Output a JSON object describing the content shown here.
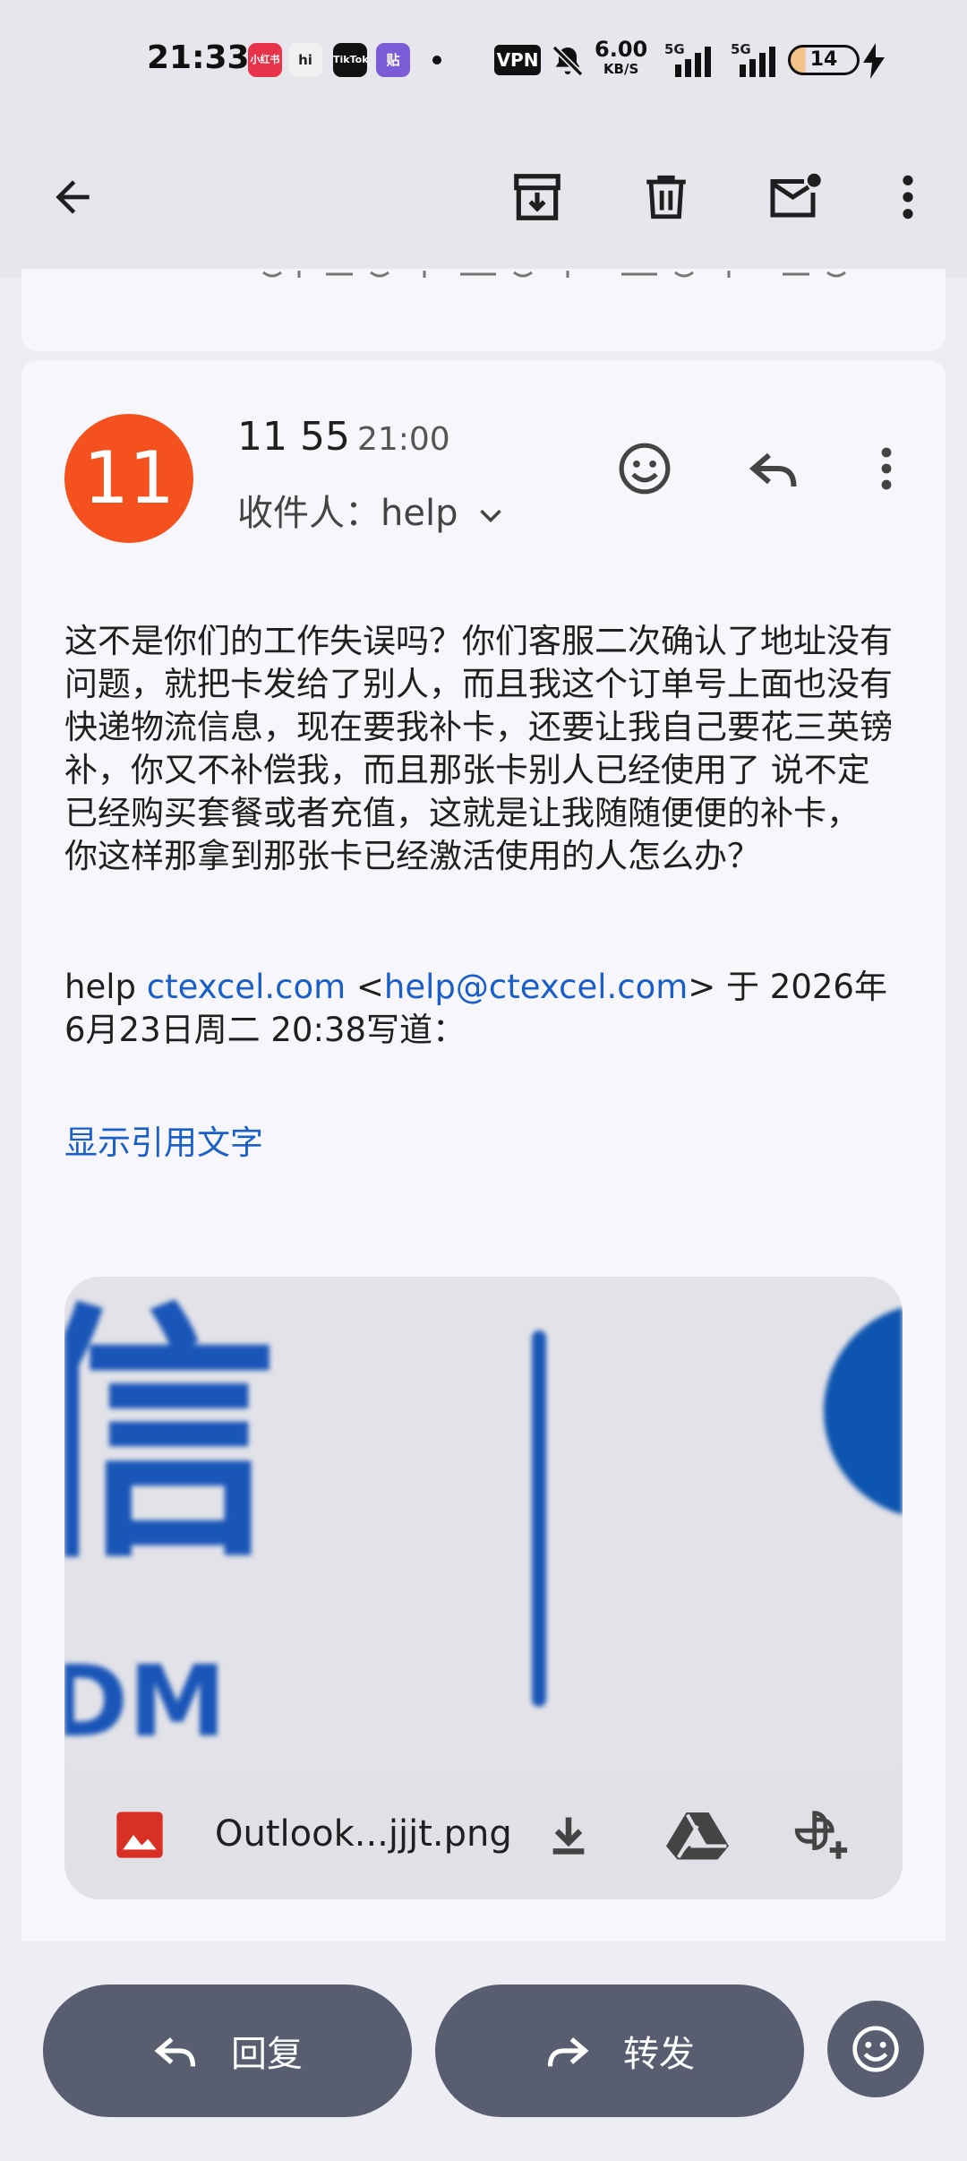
{
  "status_bar": {
    "time": "21:33",
    "vpn": "VPN",
    "speed_value": "6.00",
    "speed_unit": "KB/S",
    "net1": "5G",
    "net2": "5G",
    "battery": "14",
    "app_icons": [
      "小红书",
      "hi",
      "TikTok",
      "贴"
    ]
  },
  "toolbar": {
    "icons": [
      "back-arrow-icon",
      "archive-icon",
      "delete-icon",
      "mark-unread-icon",
      "more-vert-icon"
    ]
  },
  "message": {
    "avatar_text": "11",
    "avatar_color": "#f4511e",
    "sender": "11 55",
    "time": "21:00",
    "recipients_label": "收件人：",
    "recipient": "help",
    "body": "这不是你们的工作失误吗？你们客服二次确认了地址没有问题，就把卡发给了别人，而且我这个订单号上面也没有快递物流信息，现在要我补卡，还要让我自己要花三英镑补，你又不补偿我，而且那张卡别人已经使用了 说不定已经购买套餐或者充值，这就是让我随随便便的补卡， 你这样那拿到那张卡已经激活使用的人怎么办？",
    "quote_name": "help",
    "quote_domain": "ctexcel.com",
    "quote_lt": "<",
    "quote_email": "help@ctexcel.com",
    "quote_rest": "> 于 2026年6月23日周二 20:38写道：",
    "show_quoted": "显示引用文字"
  },
  "attachment": {
    "filename": "Outlook...jjjt.png",
    "preview_char": "信",
    "preview_letters": "DM"
  },
  "bottom_bar": {
    "reply_label": "回复",
    "forward_label": "转发"
  },
  "colors": {
    "accent_link": "#1a5fc9",
    "button_bg": "#585d70",
    "background": "#ededf3"
  }
}
